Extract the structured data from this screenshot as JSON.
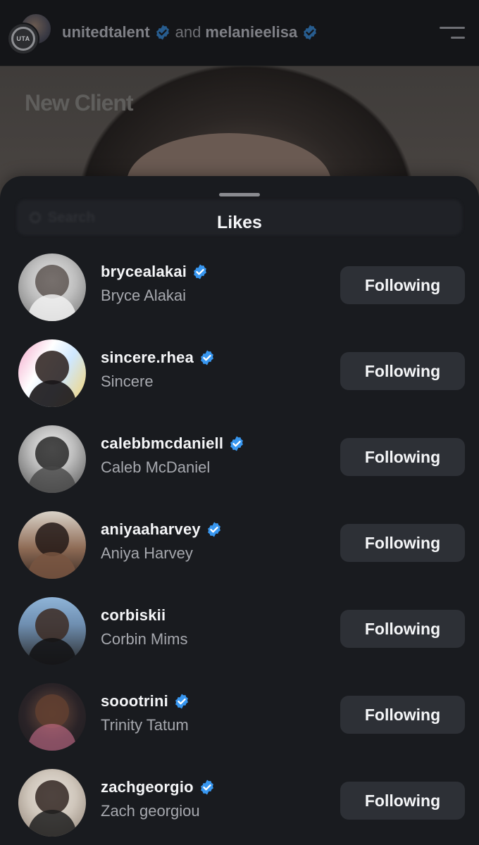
{
  "header": {
    "account_1": "unitedtalent",
    "connector": "and",
    "account_2": "melanieelisa",
    "uta_logo_text": "UTA"
  },
  "post": {
    "overlay_text": "New Client"
  },
  "sheet": {
    "title": "Likes",
    "search_placeholder": "Search"
  },
  "likes": [
    {
      "username": "brycealakai",
      "full_name": "Bryce Alakai",
      "verified": true,
      "button": "Following"
    },
    {
      "username": "sincere.rhea",
      "full_name": "Sincere",
      "verified": true,
      "button": "Following"
    },
    {
      "username": "calebbmcdaniell",
      "full_name": "Caleb McDaniel",
      "verified": true,
      "button": "Following"
    },
    {
      "username": "aniyaaharvey",
      "full_name": "Aniya Harvey",
      "verified": true,
      "button": "Following"
    },
    {
      "username": "corbiskii",
      "full_name": "Corbin Mims",
      "verified": false,
      "button": "Following"
    },
    {
      "username": "soootrini",
      "full_name": "Trinity Tatum",
      "verified": true,
      "button": "Following"
    },
    {
      "username": "zachgeorgio",
      "full_name": "Zach georgiou",
      "verified": true,
      "button": "Following"
    }
  ],
  "colors": {
    "sheet_bg": "#191b1f",
    "button_bg": "#2d3036",
    "verified_blue": "#3897f0",
    "text_primary": "#f4f5f7",
    "text_secondary": "#a6a8ae"
  },
  "icons": {
    "verified": "verified-badge-icon",
    "menu": "hamburger-menu-icon",
    "search": "search-icon"
  }
}
